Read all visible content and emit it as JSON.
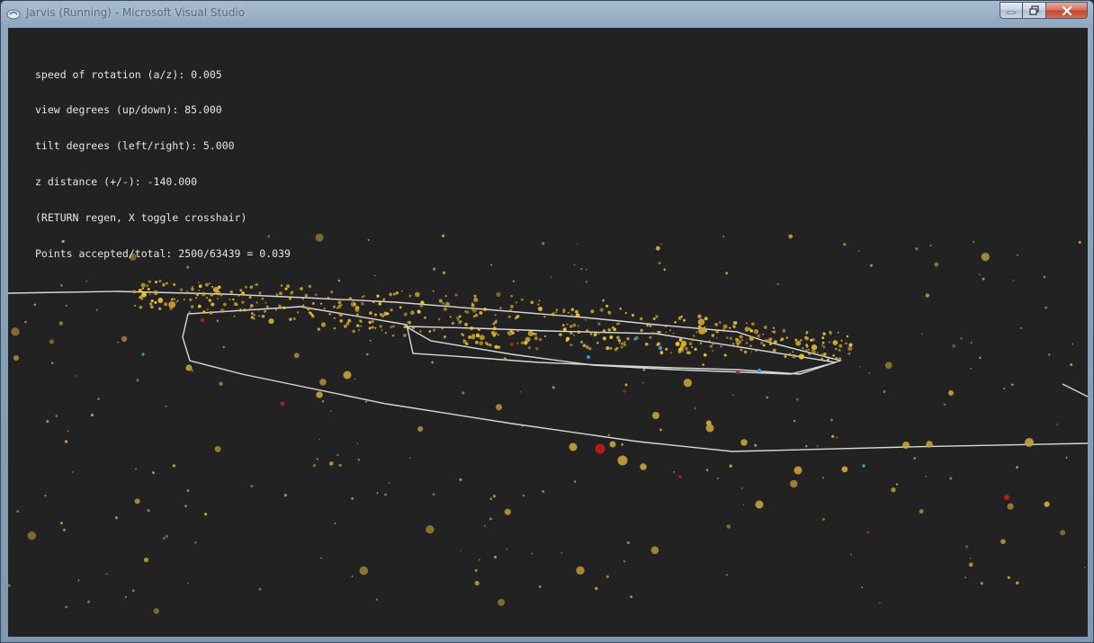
{
  "window": {
    "title": "Jarvis (Running) - Microsoft Visual Studio",
    "minimize_icon": "minimize-icon",
    "maximize_icon": "restore-icon",
    "close_icon": "close-icon"
  },
  "hud": {
    "line1": "speed of rotation (a/z): 0.005",
    "line2": "view degrees (up/down): 85.000",
    "line3": "tilt degrees (left/right): 5.000",
    "line4": "z distance (+/-): -140.000",
    "line5": "(RETURN regen, X toggle crosshair)",
    "line6": "Points accepted/total: 2500/63439 = 0.039"
  },
  "colors": {
    "background": "#222222",
    "outline": "#d8d8d8",
    "dot_gold": "#c9a23a",
    "dot_yellow": "#f2c530",
    "dot_red": "#b8201c",
    "dot_cyan": "#28a8e0"
  }
}
